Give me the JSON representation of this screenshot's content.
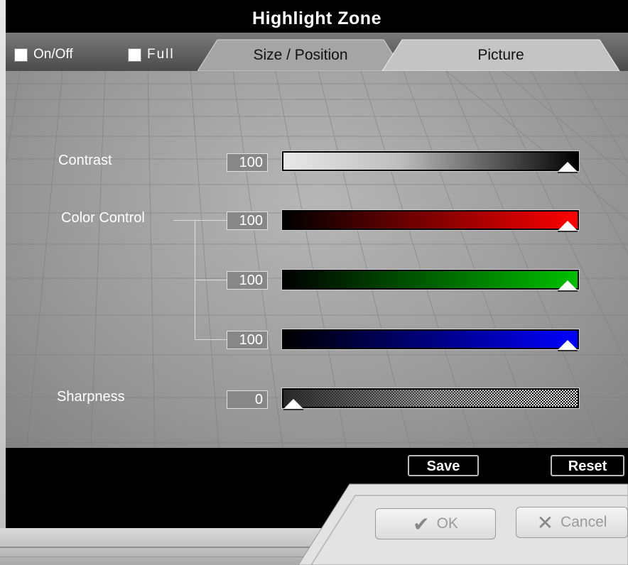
{
  "window": {
    "title": "Highlight Zone"
  },
  "toggles": {
    "onoff_label": "On/Off",
    "full_label": "Full"
  },
  "tabs": [
    {
      "label": "Size / Position",
      "active": false
    },
    {
      "label": "Picture",
      "active": true
    }
  ],
  "controls": {
    "contrast": {
      "label": "Contrast",
      "value": "100",
      "level": 1.0
    },
    "color_control": {
      "label": "Color Control",
      "red": {
        "value": "100",
        "level": 1.0
      },
      "green": {
        "value": "100",
        "level": 1.0
      },
      "blue": {
        "value": "100",
        "level": 1.0
      }
    },
    "sharpness": {
      "label": "Sharpness",
      "value": "0",
      "level": 0.0
    }
  },
  "actions": {
    "save_label": "Save",
    "reset_label": "Reset"
  },
  "dialog_buttons": {
    "ok_label": "OK",
    "cancel_label": "Cancel"
  },
  "colors": {
    "red": "#ff0000",
    "green": "#00c000",
    "blue": "#0000ff"
  },
  "icons": {
    "ok": "checkmark-icon",
    "cancel": "x-icon"
  }
}
